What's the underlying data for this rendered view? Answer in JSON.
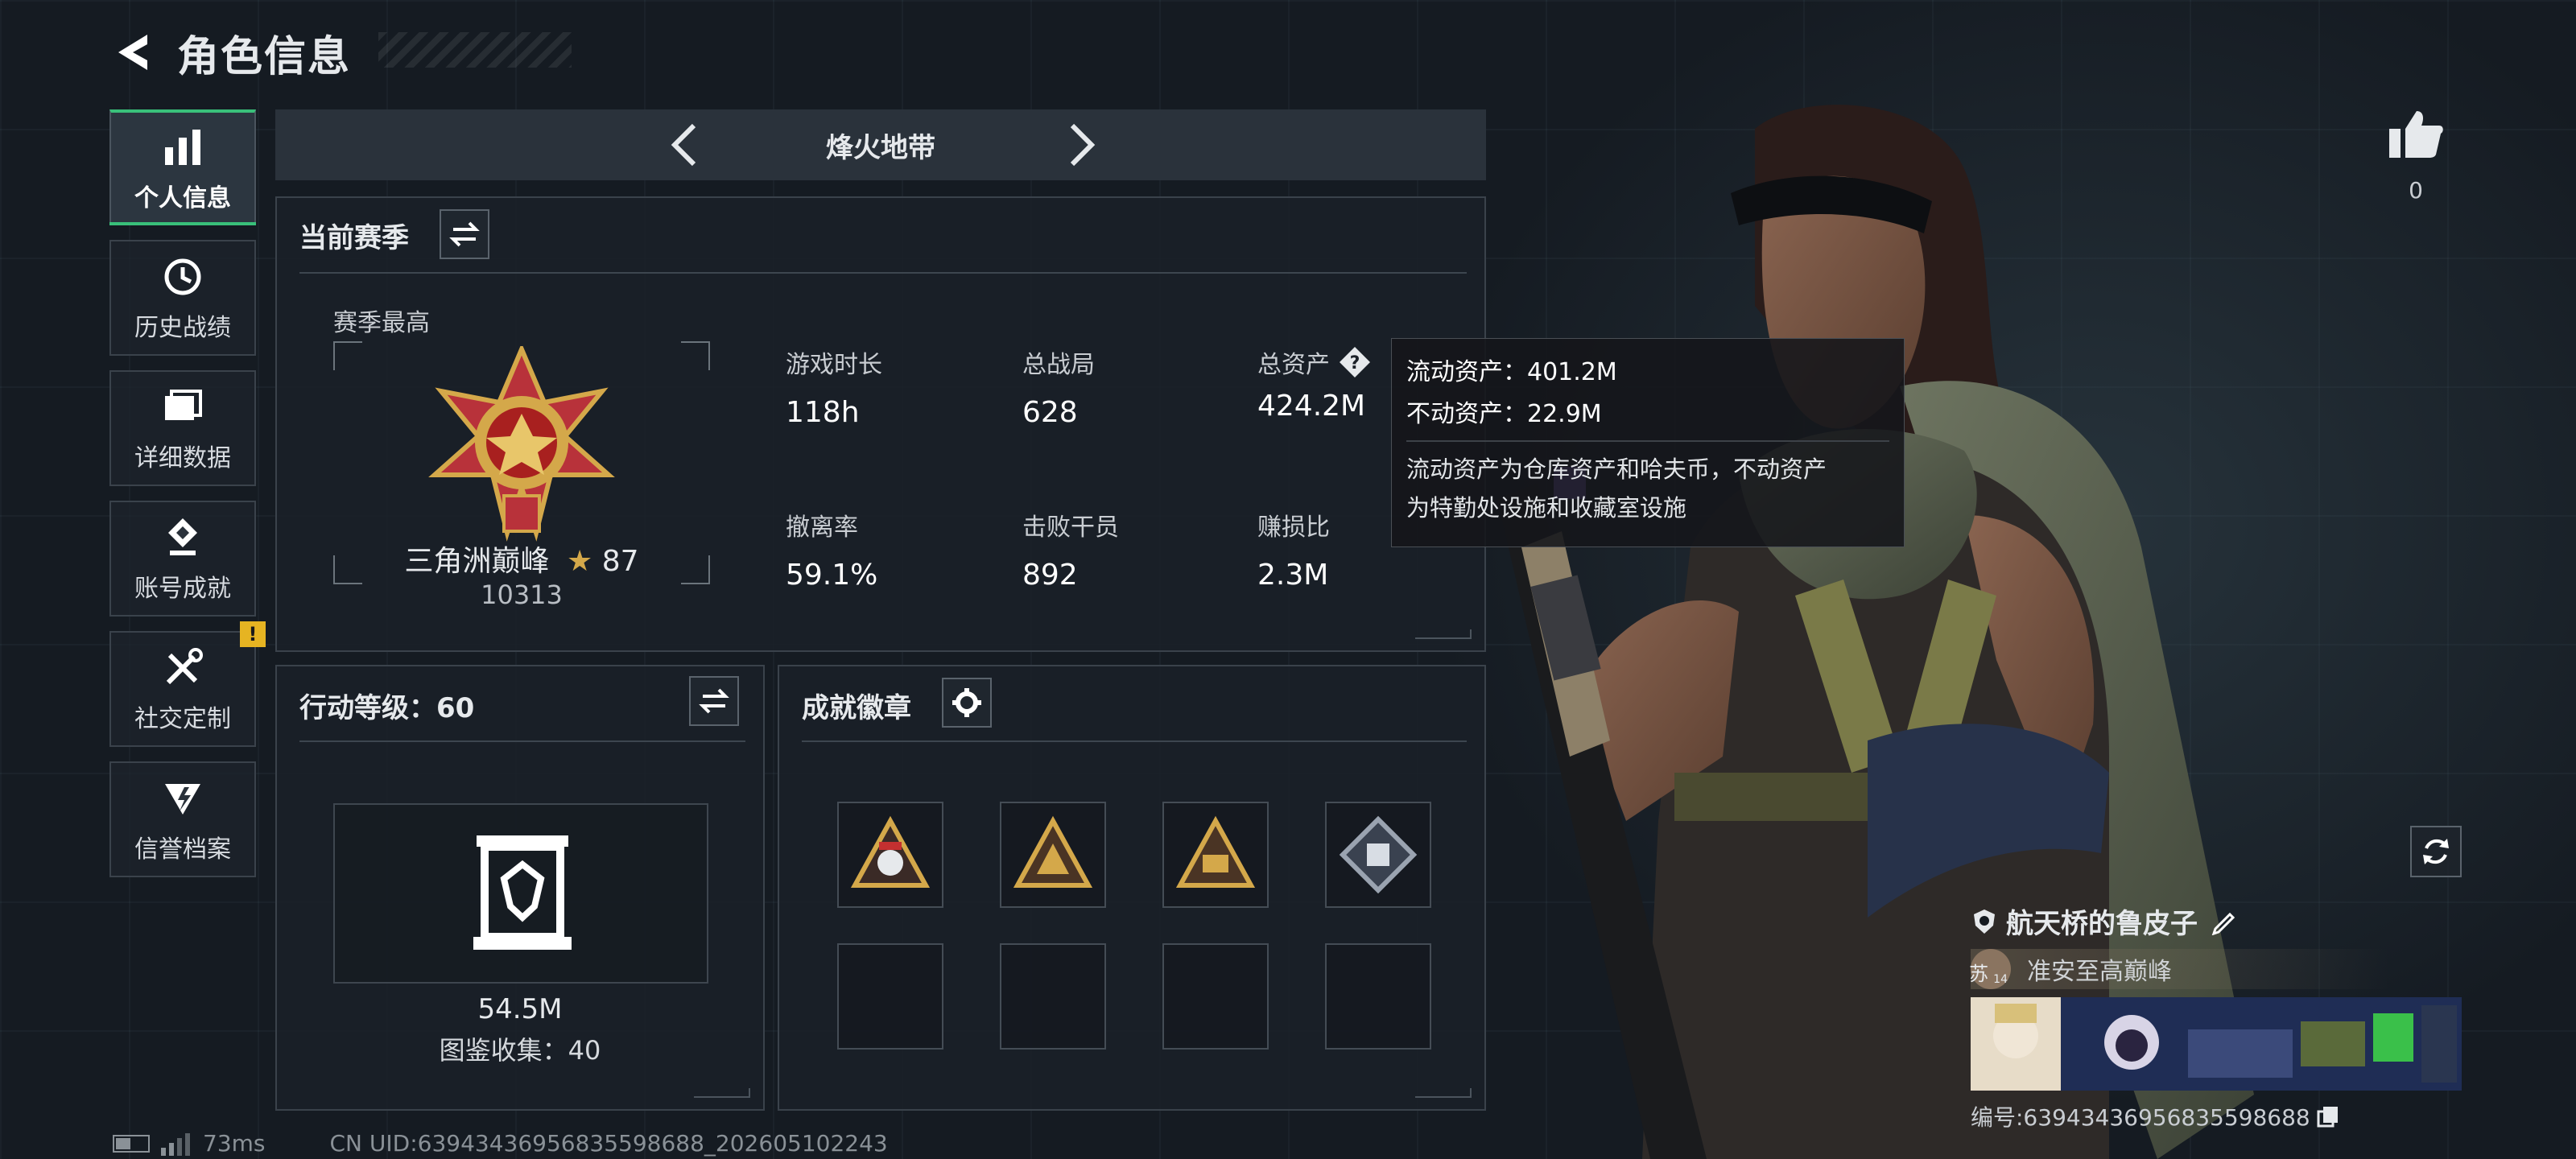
{
  "header": {
    "title": "角色信息"
  },
  "sidebar": {
    "items": [
      {
        "label": "个人信息",
        "icon": "bar-chart-icon",
        "active": true
      },
      {
        "label": "历史战绩",
        "icon": "history-icon"
      },
      {
        "label": "详细数据",
        "icon": "folder-icon"
      },
      {
        "label": "账号成就",
        "icon": "achievement-icon"
      },
      {
        "label": "社交定制",
        "icon": "tools-icon",
        "badge": "!"
      },
      {
        "label": "信誉档案",
        "icon": "credit-icon"
      }
    ]
  },
  "mode": {
    "title": "烽火地带"
  },
  "season": {
    "title": "当前赛季",
    "best_label": "赛季最高",
    "rank_name": "三角洲巅峰",
    "rank_stars": "87",
    "rank_score": "10313",
    "stats": [
      {
        "label": "游戏时长",
        "value": "118h"
      },
      {
        "label": "总战局",
        "value": "628"
      },
      {
        "label": "总资产",
        "value": "424.2M"
      },
      {
        "label": "撤离率",
        "value": "59.1%"
      },
      {
        "label": "击败干员",
        "value": "892"
      },
      {
        "label": "赚损比",
        "value": "2.3M"
      }
    ]
  },
  "tooltip": {
    "liquid": "流动资产：401.2M",
    "fixed": "不动资产：22.9M",
    "desc_line1": "流动资产为仓库资产和哈夫币，不动资产",
    "desc_line2": "为特勤处设施和收藏室设施"
  },
  "action_level": {
    "title": "行动等级：60",
    "value": "54.5M",
    "collection": "图鉴收集：40"
  },
  "badges": {
    "title": "成就徽章"
  },
  "like": {
    "count": "0"
  },
  "player": {
    "name": "航天桥的鲁皮子",
    "title": "准安至高巅峰",
    "level": "14",
    "avatar_char": "苏",
    "id": "编号:6394343695683559868​8"
  },
  "footer": {
    "ping": "73ms",
    "uid": "CN UID:6394343695683559868​8_202605102243"
  },
  "colors": {
    "accent": "#39c07a",
    "warning": "#e6b422",
    "gold": "#d4a84a"
  }
}
